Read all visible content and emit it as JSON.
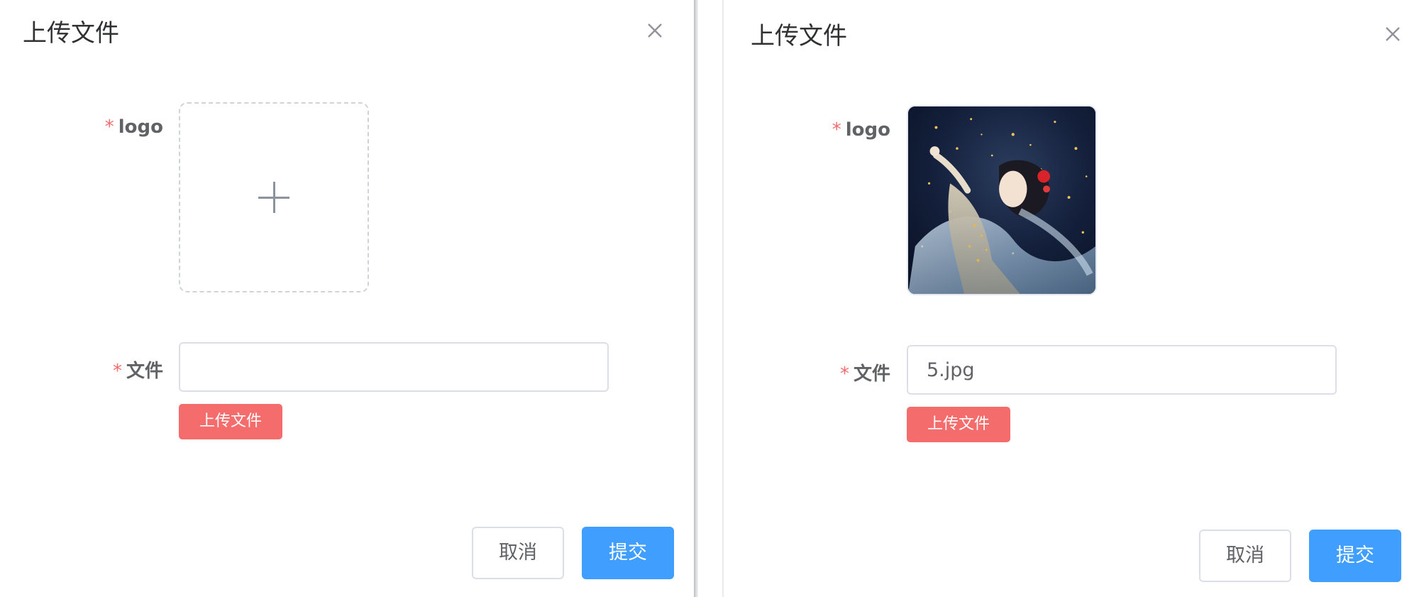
{
  "dialogs": [
    {
      "title": "上传文件",
      "logo_label": "logo",
      "logo_state": "empty",
      "file_label": "文件",
      "file_value": "",
      "upload_button": "上传文件",
      "cancel_button": "取消",
      "submit_button": "提交"
    },
    {
      "title": "上传文件",
      "logo_label": "logo",
      "logo_state": "image",
      "file_label": "文件",
      "file_value": "5.jpg",
      "upload_button": "上传文件",
      "cancel_button": "取消",
      "submit_button": "提交"
    }
  ],
  "required_mark": "*",
  "colors": {
    "required": "#f56c6c",
    "upload_button": "#f56c6c",
    "primary": "#409eff",
    "border": "#dcdfe6"
  },
  "icons": {
    "close": "close-icon",
    "plus": "plus-icon"
  }
}
